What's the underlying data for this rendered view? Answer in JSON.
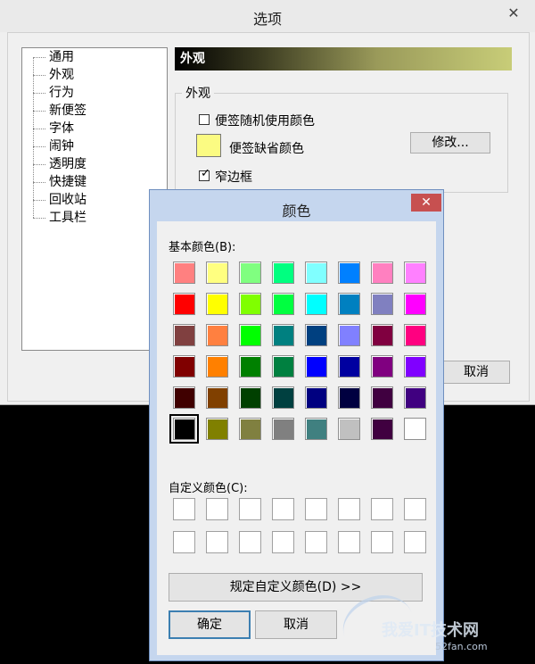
{
  "options": {
    "title": "选项",
    "close_glyph": "✕",
    "tree": [
      "通用",
      "外观",
      "行为",
      "新便签",
      "字体",
      "闹钟",
      "透明度",
      "快捷键",
      "回收站",
      "工具栏"
    ],
    "header": "外观",
    "group_label": "外观",
    "random_color_label": "便签随机使用颜色",
    "default_color_label": "便签缺省颜色",
    "default_color": "#fbfb82",
    "modify_button": "修改...",
    "narrow_border_label": "窄边框",
    "narrow_border_mark": "✓",
    "cancel_button": "取消"
  },
  "color_dialog": {
    "title": "颜色",
    "close_glyph": "✕",
    "basic_colors_label": "基本颜色(B):",
    "basic_colors": [
      "#ff8080",
      "#ffff80",
      "#80ff80",
      "#00ff80",
      "#80ffff",
      "#0080ff",
      "#ff80c0",
      "#ff80ff",
      "#ff0000",
      "#ffff00",
      "#80ff00",
      "#00ff40",
      "#00ffff",
      "#0080c0",
      "#8080c0",
      "#ff00ff",
      "#804040",
      "#ff8040",
      "#00ff00",
      "#008080",
      "#004080",
      "#8080ff",
      "#800040",
      "#ff0080",
      "#800000",
      "#ff8000",
      "#008000",
      "#008040",
      "#0000ff",
      "#0000a0",
      "#800080",
      "#8000ff",
      "#400000",
      "#804000",
      "#004000",
      "#004040",
      "#000080",
      "#000040",
      "#400040",
      "#400080",
      "#000000",
      "#808000",
      "#808040",
      "#808080",
      "#408080",
      "#c0c0c0",
      "#400040",
      "#ffffff"
    ],
    "selected_index": 40,
    "custom_colors_label": "自定义颜色(C):",
    "custom_colors": [
      "#ffffff",
      "#ffffff",
      "#ffffff",
      "#ffffff",
      "#ffffff",
      "#ffffff",
      "#ffffff",
      "#ffffff",
      "#ffffff",
      "#ffffff",
      "#ffffff",
      "#ffffff",
      "#ffffff",
      "#ffffff",
      "#ffffff",
      "#ffffff"
    ],
    "define_custom_button": "规定自定义颜色(D) >>",
    "ok_button": "确定",
    "cancel_button": "取消"
  },
  "watermark": {
    "text": "我爱IT技术网",
    "sub": "52fan.com"
  }
}
